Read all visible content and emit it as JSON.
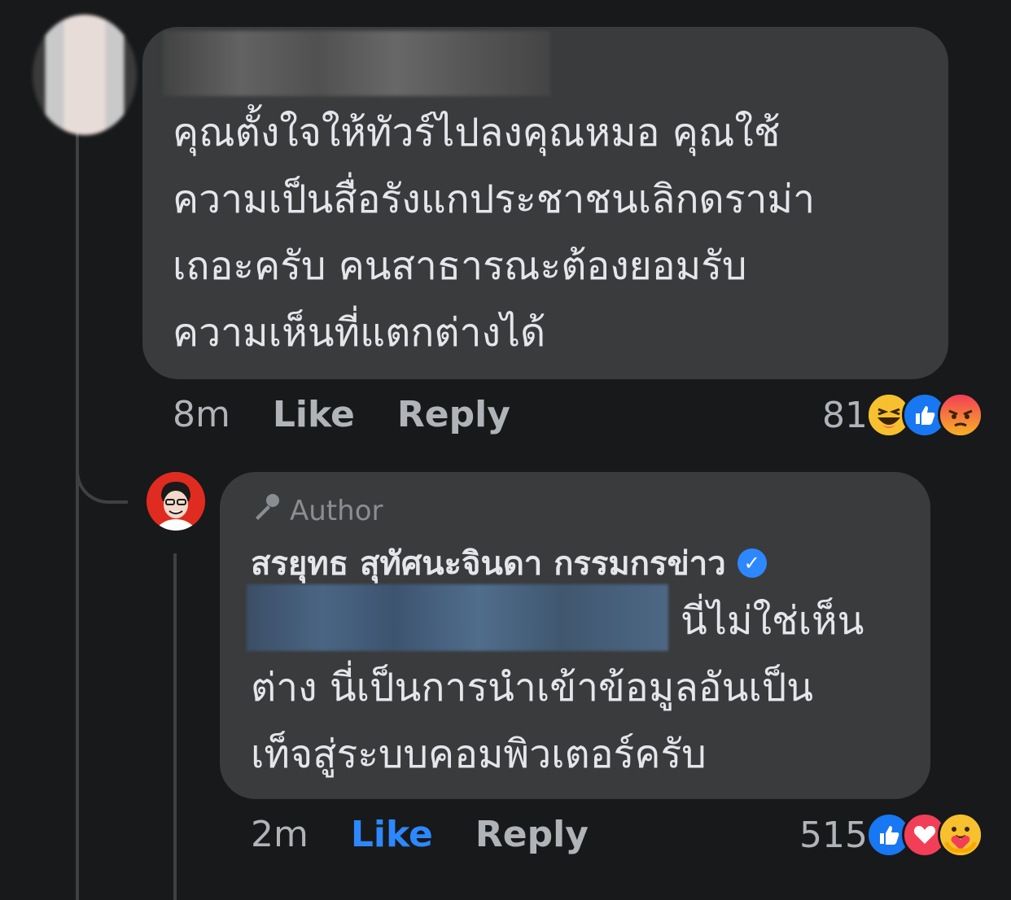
{
  "comment": {
    "text": "คุณตั้งใจให้ทัวร์ไปลงคุณหมอ คุณใช้\nความเป็นสื่อรังแกประชาชนเลิกดราม่า\nเถอะครับ คนสาธารณะต้องยอมรับ\nความเห็นที่แตกต่างได้",
    "time": "8m",
    "like_label": "Like",
    "reply_label": "Reply",
    "reaction_count": "81",
    "reactions": [
      "haha-icon",
      "like-icon",
      "angry-icon"
    ]
  },
  "reply": {
    "badge": "Author",
    "author_name": "สรยุทธ สุทัศนะจินดา กรรมกรข่าว",
    "text_first_line": "นี่ไม่ใช่เห็น",
    "text": "ต่าง นี่เป็นการนำเข้าข้อมูลอันเป็น\nเท็จสู่ระบบคอมพิวเตอร์ครับ",
    "time": "2m",
    "like_label": "Like",
    "reply_label": "Reply",
    "reaction_count": "515",
    "reactions": [
      "like-icon",
      "love-icon",
      "care-icon"
    ]
  },
  "colors": {
    "background": "#18191a",
    "bubble": "#3a3b3c",
    "text": "#e4e6eb",
    "secondary_text": "#b0b3b8",
    "accent": "#2d88ff"
  }
}
